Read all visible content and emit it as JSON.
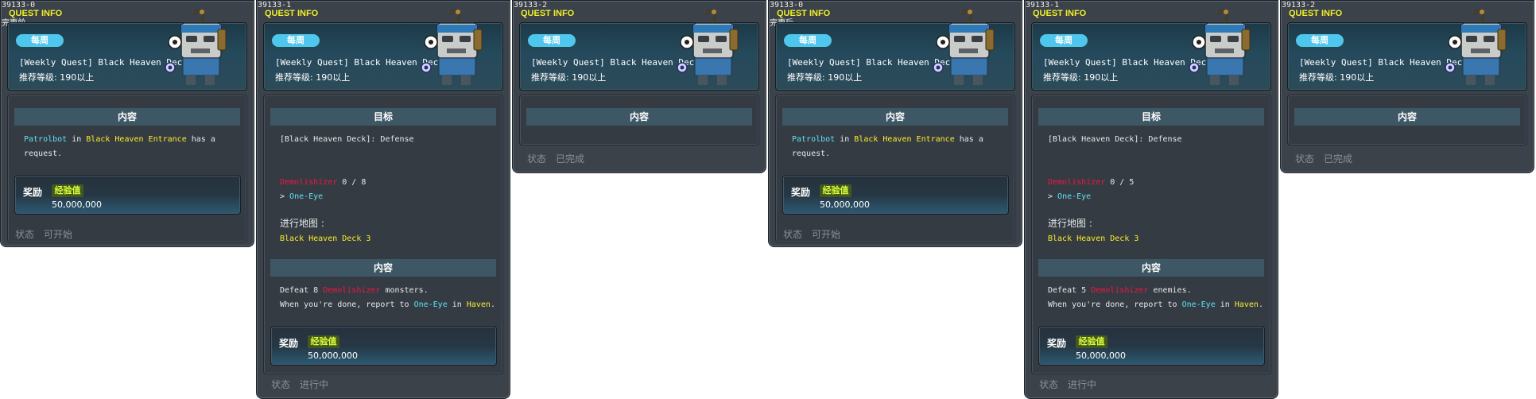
{
  "common": {
    "window_title": "QUEST INFO",
    "quest_name": "[Weekly Quest] Black Heaven Dec...",
    "level_text": "推荐等级: 190以上",
    "badge": "每周",
    "content_header": "内容",
    "goal_header": "目标",
    "reward_label": "奖励",
    "exp_label": "经验值",
    "exp_value": "50,000,000",
    "status_label": "状态",
    "colors": {
      "cyan": "#5ee2f5",
      "yellow": "#f8ee2a",
      "red": "#ef1547",
      "badge": "#4fc7ec"
    }
  },
  "panels": [
    {
      "id": "39133-0",
      "subtitle": "完更前",
      "intro": {
        "npc": "Patrolbot",
        "in": " in ",
        "place": "Black Heaven Entrance",
        "tail": " has a",
        "line2": "request."
      },
      "status": "可开始"
    },
    {
      "id": "39133-1",
      "goal_line": "[Black Heaven Deck]: Defense",
      "monster": "Demolishizer",
      "count": " 0 / 8",
      "npc_line_prefix": "> ",
      "npc": "One-Eye",
      "map_label": "进行地图 :",
      "map": "Black Heaven Deck 3",
      "desc1_prefix": "Defeat 8 ",
      "desc1_monster": "Demolishizer",
      "desc1_suffix": " monsters.",
      "desc2_prefix": "When you're done, report to ",
      "desc2_npc": "One-Eye",
      "desc2_mid": " in ",
      "desc2_place": "Haven",
      "desc2_end": ".",
      "status": "进行中"
    },
    {
      "id": "39133-2",
      "status": "已完成"
    },
    {
      "id": "39133-0",
      "subtitle": "完更后",
      "intro": {
        "npc": "Patrolbot",
        "in": " in ",
        "place": "Black Heaven Entrance",
        "tail": " has a",
        "line2": "request."
      },
      "status": "可开始"
    },
    {
      "id": "39133-1",
      "goal_line": "[Black Heaven Deck]: Defense",
      "monster": "Demolishizer",
      "count": " 0 / 5",
      "npc_line_prefix": "> ",
      "npc": "One-Eye",
      "map_label": "进行地图 :",
      "map": "Black Heaven Deck 3",
      "desc1_prefix": "Defeat 5 ",
      "desc1_monster": "Demolishizer",
      "desc1_suffix": " enemies.",
      "desc2_prefix": "When you're done, report to ",
      "desc2_npc": "One-Eye",
      "desc2_mid": " in ",
      "desc2_place": "Haven",
      "desc2_end": ".",
      "status": "进行中"
    },
    {
      "id": "39133-2",
      "status": "已完成"
    }
  ]
}
